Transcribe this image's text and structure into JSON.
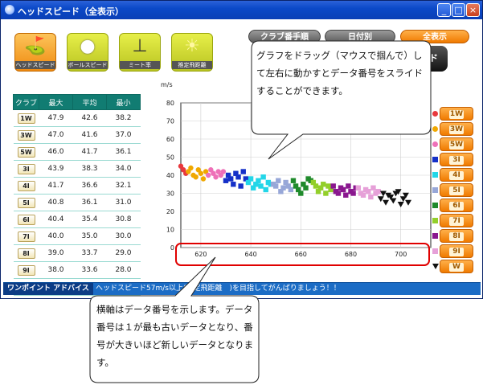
{
  "window": {
    "title": "ヘッドスピード（全表示）"
  },
  "top_icons": [
    {
      "label": "ヘッドスピード",
      "icon": "driver-head-icon",
      "glyph": "⛳"
    },
    {
      "label": "ボールスピード",
      "icon": "golf-ball-icon",
      "glyph": "●"
    },
    {
      "label": "ミート率",
      "icon": "tee-ball-icon",
      "glyph": "⊥"
    },
    {
      "label": "推定飛距離",
      "icon": "distance-icon",
      "glyph": "☀"
    }
  ],
  "sort_buttons": {
    "club_order": "クラブ番手順",
    "by_date": "日付別",
    "show_all": "全表示"
  },
  "table": {
    "headers": [
      "クラブ",
      "最大",
      "平均",
      "最小"
    ],
    "rows": [
      [
        "1W",
        "47.9",
        "42.6",
        "38.2"
      ],
      [
        "3W",
        "47.0",
        "41.6",
        "37.0"
      ],
      [
        "5W",
        "46.0",
        "41.7",
        "36.1"
      ],
      [
        "3I",
        "43.9",
        "38.3",
        "34.0"
      ],
      [
        "4I",
        "41.7",
        "36.6",
        "32.1"
      ],
      [
        "5I",
        "40.8",
        "36.1",
        "31.0"
      ],
      [
        "6I",
        "40.4",
        "35.4",
        "30.8"
      ],
      [
        "7I",
        "40.0",
        "35.0",
        "30.0"
      ],
      [
        "8I",
        "39.0",
        "33.7",
        "29.0"
      ],
      [
        "9I",
        "38.0",
        "33.6",
        "28.0"
      ],
      [
        "W",
        "35.0",
        "29.7",
        "25.0"
      ]
    ]
  },
  "legend": [
    {
      "club": "1W",
      "color": "#e8383d",
      "marker": "circle"
    },
    {
      "club": "3W",
      "color": "#f0a800",
      "marker": "circle"
    },
    {
      "club": "5W",
      "color": "#ee70b8",
      "marker": "circle"
    },
    {
      "club": "3I",
      "color": "#1530c8",
      "marker": "square"
    },
    {
      "club": "4I",
      "color": "#23d6e8",
      "marker": "square"
    },
    {
      "club": "5I",
      "color": "#97a7d8",
      "marker": "square"
    },
    {
      "club": "6I",
      "color": "#1f8a2b",
      "marker": "square"
    },
    {
      "club": "7I",
      "color": "#93cf2a",
      "marker": "square"
    },
    {
      "club": "8I",
      "color": "#8a178f",
      "marker": "square"
    },
    {
      "club": "9I",
      "color": "#e6a0d8",
      "marker": "square"
    },
    {
      "club": "W",
      "color": "#111111",
      "marker": "triangle"
    }
  ],
  "chart_data": {
    "type": "scatter",
    "ylabel": "m/s",
    "xlim": [
      612,
      712
    ],
    "ylim": [
      0,
      80
    ],
    "x_ticks": [
      620,
      640,
      660,
      680,
      700
    ],
    "y_ticks": [
      0,
      10,
      20,
      30,
      40,
      50,
      60,
      70,
      80
    ],
    "grid": true,
    "series": [
      {
        "name": "1W",
        "x": [
          612,
          613,
          614
        ],
        "y": [
          45,
          43,
          41
        ]
      },
      {
        "name": "3W",
        "x": [
          615,
          616,
          617,
          618,
          619,
          620,
          621,
          622
        ],
        "y": [
          42,
          44,
          40,
          39,
          43,
          41,
          38,
          42
        ]
      },
      {
        "name": "5W",
        "x": [
          623,
          624,
          625,
          626,
          627,
          628,
          629
        ],
        "y": [
          40,
          43,
          41,
          39,
          42,
          40,
          42
        ]
      },
      {
        "name": "3I",
        "x": [
          630,
          631,
          632,
          633,
          634,
          635,
          636,
          637,
          638
        ],
        "y": [
          37,
          40,
          38,
          35,
          41,
          39,
          34,
          42,
          38
        ]
      },
      {
        "name": "4I",
        "x": [
          639,
          640,
          641,
          642,
          643,
          644,
          645,
          646,
          647,
          648
        ],
        "y": [
          36,
          38,
          33,
          35,
          37,
          34,
          39,
          32,
          36,
          35
        ]
      },
      {
        "name": "5I",
        "x": [
          649,
          650,
          651,
          652,
          653,
          654,
          655,
          656
        ],
        "y": [
          35,
          34,
          37,
          31,
          33,
          36,
          34,
          32
        ]
      },
      {
        "name": "6I",
        "x": [
          657,
          658,
          659,
          660,
          661,
          662,
          663,
          664
        ],
        "y": [
          37,
          34,
          32,
          30,
          35,
          33,
          38,
          37
        ]
      },
      {
        "name": "7I",
        "x": [
          665,
          666,
          667,
          668,
          669,
          670,
          671,
          672
        ],
        "y": [
          36,
          34,
          31,
          33,
          35,
          30,
          34,
          32
        ]
      },
      {
        "name": "8I",
        "x": [
          673,
          674,
          675,
          676,
          677,
          678,
          679,
          680,
          681,
          682
        ],
        "y": [
          34,
          31,
          30,
          33,
          32,
          29,
          34,
          31,
          30,
          33
        ]
      },
      {
        "name": "9I",
        "x": [
          683,
          684,
          685,
          686,
          687,
          688,
          689,
          690,
          691
        ],
        "y": [
          33,
          30,
          29,
          32,
          31,
          28,
          33,
          30,
          31
        ]
      },
      {
        "name": "W",
        "x": [
          692,
          693,
          694,
          695,
          696,
          697,
          698,
          699,
          700,
          701,
          702,
          703
        ],
        "y": [
          27,
          30,
          25,
          29,
          28,
          26,
          30,
          31,
          24,
          27,
          29,
          25
        ]
      }
    ]
  },
  "advice": {
    "label": "ワンポイント アドバイス",
    "text": "ヘッドスピード57m/s以上(推定飛距離　)を目指してがんばりましょう！！"
  }
}
